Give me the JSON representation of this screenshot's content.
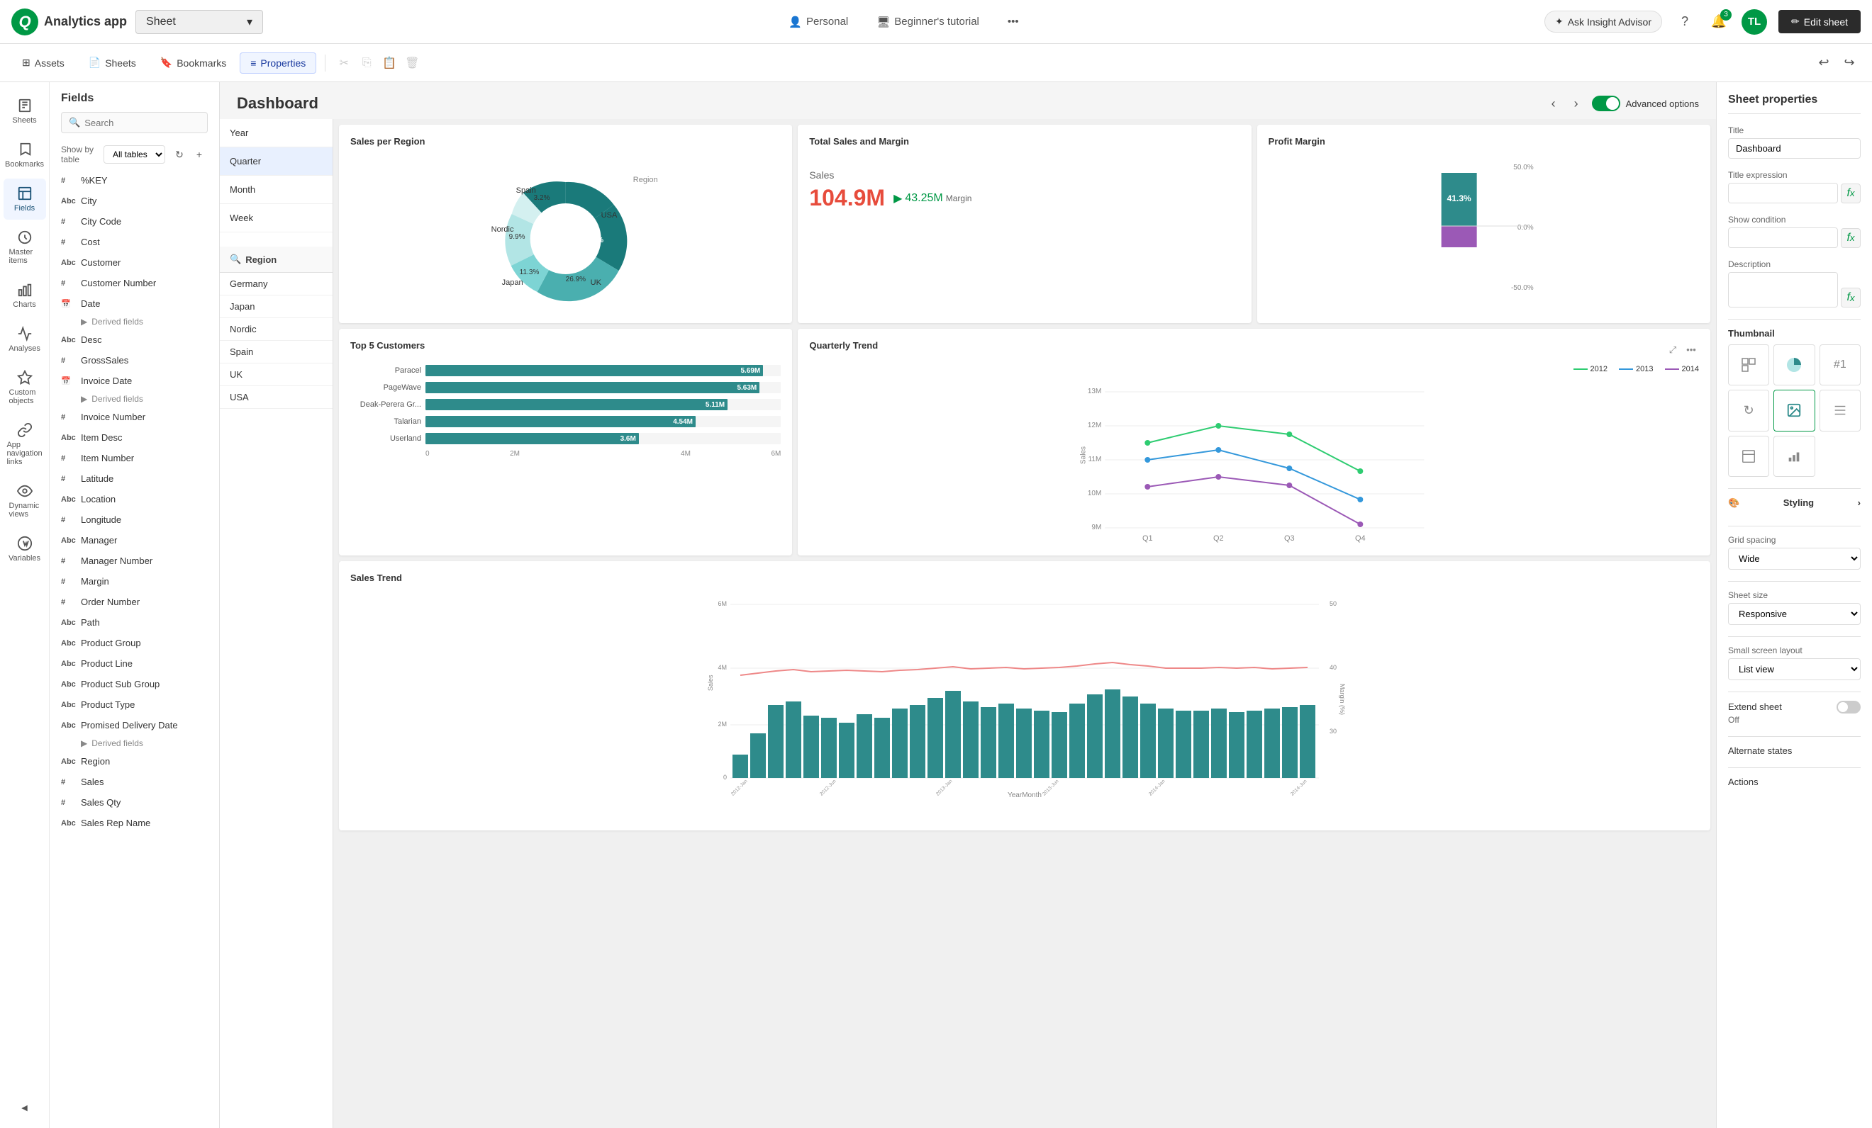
{
  "topbar": {
    "app_name": "Analytics app",
    "sheet_label": "Sheet",
    "personal": "Personal",
    "tutorial": "Beginner's tutorial",
    "insight_placeholder": "Ask Insight Advisor",
    "notification_count": "3",
    "avatar_initials": "TL",
    "edit_sheet": "Edit sheet"
  },
  "secondbar": {
    "assets": "Assets",
    "sheets": "Sheets",
    "bookmarks": "Bookmarks",
    "properties": "Properties"
  },
  "fields_panel": {
    "title": "Fields",
    "search_placeholder": "Search",
    "show_by_table_label": "Show by table",
    "table_option": "All tables",
    "fields": [
      {
        "type": "#",
        "name": "%KEY"
      },
      {
        "type": "Abc",
        "name": "City"
      },
      {
        "type": "#",
        "name": "City Code"
      },
      {
        "type": "#",
        "name": "Cost"
      },
      {
        "type": "Abc",
        "name": "Customer"
      },
      {
        "type": "#",
        "name": "Customer Number"
      },
      {
        "type": "📅",
        "name": "Date",
        "has_derived": true,
        "derived_label": "Derived fields"
      },
      {
        "type": "Abc",
        "name": "Desc"
      },
      {
        "type": "#",
        "name": "GrossSales"
      },
      {
        "type": "📅",
        "name": "Invoice Date",
        "has_derived": true,
        "derived_label": "Derived fields"
      },
      {
        "type": "#",
        "name": "Invoice Number"
      },
      {
        "type": "Abc",
        "name": "Item Desc"
      },
      {
        "type": "#",
        "name": "Item Number"
      },
      {
        "type": "#",
        "name": "Latitude"
      },
      {
        "type": "Abc",
        "name": "Location"
      },
      {
        "type": "#",
        "name": "Longitude"
      },
      {
        "type": "Abc",
        "name": "Manager"
      },
      {
        "type": "#",
        "name": "Manager Number"
      },
      {
        "type": "#",
        "name": "Margin"
      },
      {
        "type": "#",
        "name": "Order Number"
      },
      {
        "type": "Abc",
        "name": "Path"
      },
      {
        "type": "Abc",
        "name": "Product Group"
      },
      {
        "type": "Abc",
        "name": "Product Line"
      },
      {
        "type": "Abc",
        "name": "Product Sub Group"
      },
      {
        "type": "Abc",
        "name": "Product Type"
      },
      {
        "type": "Abc",
        "name": "Promised Delivery Date",
        "has_derived": true,
        "derived_label": "Derived fields"
      },
      {
        "type": "Abc",
        "name": "Region"
      },
      {
        "type": "#",
        "name": "Sales"
      },
      {
        "type": "#",
        "name": "Sales Qty"
      },
      {
        "type": "Abc",
        "name": "Sales Rep Name"
      }
    ]
  },
  "filter_panel": {
    "items_top": [
      "Year",
      "Quarter",
      "Month",
      "Week"
    ],
    "region_title": "Region",
    "region_items": [
      "Germany",
      "Japan",
      "Nordic",
      "Spain",
      "UK",
      "USA"
    ]
  },
  "dashboard": {
    "title": "Dashboard",
    "advanced_options": "Advanced options"
  },
  "charts": {
    "sales_per_region": {
      "title": "Sales per Region",
      "donut": {
        "usa": 45.5,
        "uk": 26.9,
        "japan": 11.3,
        "nordic": 9.9,
        "spain": 3.2,
        "usa_label": "USA",
        "uk_label": "UK",
        "japan_label": "Japan",
        "nordic_label": "Nordic",
        "spain_label": "Spain",
        "region_label": "Region"
      }
    },
    "total_sales": {
      "title": "Total Sales and Margin",
      "sales_label": "Sales",
      "value": "104.9M",
      "margin_label": "Margin",
      "margin_value": "43.25M"
    },
    "profit_margin": {
      "title": "Profit Margin",
      "value": "41.3%",
      "pos_label": "50.0%",
      "neg_label": "-50.0%",
      "zero_label": "0.0%"
    },
    "top5_customers": {
      "title": "Top 5 Customers",
      "customers": [
        {
          "name": "Paracel",
          "value": 5690000,
          "label": "5.69M"
        },
        {
          "name": "PageWave",
          "value": 5630000,
          "label": "5.63M"
        },
        {
          "name": "Deak-Perera Gr...",
          "value": 5110000,
          "label": "5.11M"
        },
        {
          "name": "Talarian",
          "value": 4540000,
          "label": "4.54M"
        },
        {
          "name": "Userland",
          "value": 3600000,
          "label": "3.6M"
        }
      ],
      "axis_labels": [
        "0",
        "2M",
        "4M",
        "6M"
      ]
    },
    "quarterly_trend": {
      "title": "Quarterly Trend",
      "quarters": [
        "Q1",
        "Q2",
        "Q3",
        "Q4"
      ],
      "y_labels": [
        "9M",
        "10M",
        "11M",
        "12M",
        "13M"
      ],
      "years": [
        "2012",
        "2013",
        "2014"
      ],
      "sales_label": "Sales"
    },
    "sales_trend": {
      "title": "Sales Trend",
      "y_labels": [
        "0",
        "2M",
        "4M",
        "6M"
      ],
      "x_label": "YearMonth",
      "margin_label": "Margin (%)",
      "margin_right": [
        "30",
        "40",
        "50"
      ]
    }
  },
  "right_panel": {
    "title": "Sheet properties",
    "title_label": "Title",
    "title_value": "Dashboard",
    "title_expr_label": "Title expression",
    "show_cond_label": "Show condition",
    "desc_label": "Description",
    "thumbnail_label": "Thumbnail",
    "styling_label": "Styling",
    "grid_spacing_label": "Grid spacing",
    "grid_spacing_value": "Wide",
    "sheet_size_label": "Sheet size",
    "sheet_size_value": "Responsive",
    "small_screen_label": "Small screen layout",
    "small_screen_value": "List view",
    "extend_sheet_label": "Extend sheet",
    "extend_sheet_value": "Off",
    "alternate_states_label": "Alternate states",
    "actions_label": "Actions"
  },
  "leftnav": {
    "items": [
      {
        "id": "sheets",
        "label": "Sheets"
      },
      {
        "id": "bookmarks",
        "label": "Bookmarks"
      },
      {
        "id": "fields",
        "label": "Fields",
        "active": true
      },
      {
        "id": "master-items",
        "label": "Master items"
      },
      {
        "id": "charts",
        "label": "Charts"
      },
      {
        "id": "analyses",
        "label": "Analyses"
      },
      {
        "id": "custom-objects",
        "label": "Custom objects"
      },
      {
        "id": "app-nav",
        "label": "App navigation links"
      },
      {
        "id": "dynamic-views",
        "label": "Dynamic views"
      },
      {
        "id": "variables",
        "label": "Variables"
      }
    ]
  }
}
